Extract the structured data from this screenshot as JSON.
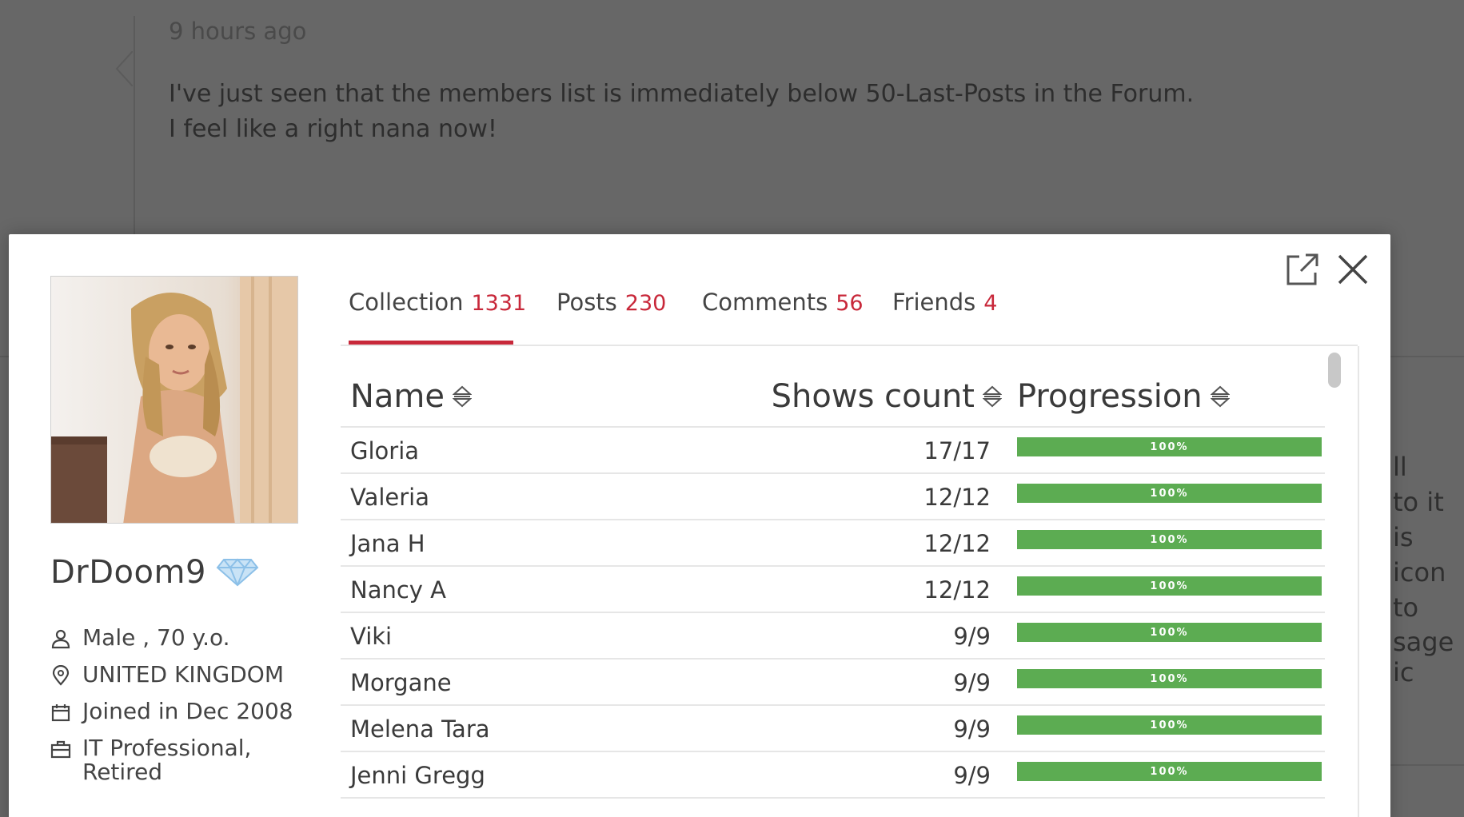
{
  "background": {
    "timestamp": "9 hours ago",
    "message": "I've just seen that the members list is immediately below 50-Last-Posts in the Forum.\nI feel like a right nana now!",
    "side_text_lines": "ll\nto it is\nicon to",
    "side_text_line2": "sage ic"
  },
  "profile": {
    "username": "DrDoom9",
    "badge_icon": "diamond-icon",
    "gender_age": "Male , 70 y.o.",
    "country": "UNITED KINGDOM",
    "joined": "Joined in Dec 2008",
    "occupation": "IT Professional,\nRetired"
  },
  "tabs": [
    {
      "label": "Collection",
      "count": "1331",
      "active": true
    },
    {
      "label": "Posts",
      "count": "230",
      "active": false
    },
    {
      "label": "Comments",
      "count": "56",
      "active": false
    },
    {
      "label": "Friends",
      "count": "4",
      "active": false
    }
  ],
  "table": {
    "headers": {
      "name": "Name",
      "shows": "Shows count",
      "progression": "Progression"
    },
    "rows": [
      {
        "name": "Gloria",
        "shows": "17/17",
        "progress_label": "100%",
        "progress": 1.0
      },
      {
        "name": "Valeria",
        "shows": "12/12",
        "progress_label": "100%",
        "progress": 1.0
      },
      {
        "name": "Jana H",
        "shows": "12/12",
        "progress_label": "100%",
        "progress": 1.0
      },
      {
        "name": "Nancy A",
        "shows": "12/12",
        "progress_label": "100%",
        "progress": 1.0
      },
      {
        "name": "Viki",
        "shows": "9/9",
        "progress_label": "100%",
        "progress": 1.0
      },
      {
        "name": "Morgane",
        "shows": "9/9",
        "progress_label": "100%",
        "progress": 1.0
      },
      {
        "name": "Melena Tara",
        "shows": "9/9",
        "progress_label": "100%",
        "progress": 1.0
      },
      {
        "name": "Jenni Gregg",
        "shows": "9/9",
        "progress_label": "100%",
        "progress": 1.0
      }
    ]
  },
  "colors": {
    "accent": "#c8283a",
    "progress": "#5cac52",
    "overlay": "#676767"
  }
}
